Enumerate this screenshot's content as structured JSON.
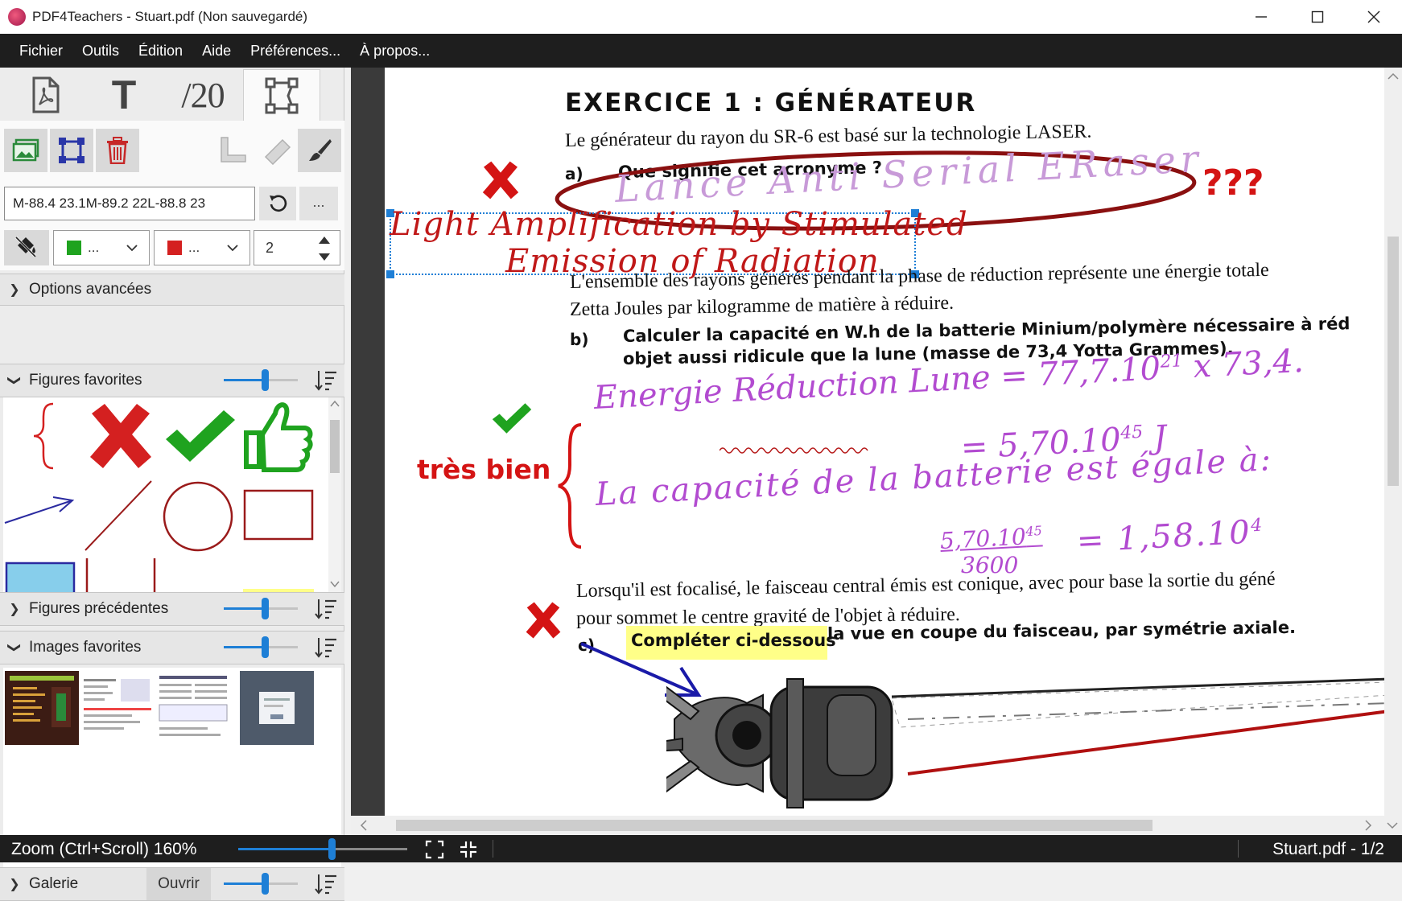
{
  "window": {
    "title": "PDF4Teachers - Stuart.pdf (Non sauvegardé)"
  },
  "menu": [
    "Fichier",
    "Outils",
    "Édition",
    "Aide",
    "Préférences...",
    "À propos..."
  ],
  "sidebar": {
    "tabs": [
      {
        "icon": "pdf-file-icon"
      },
      {
        "label": "T",
        "icon": "text-tool-icon"
      },
      {
        "label": "/20",
        "icon": "grades-icon"
      },
      {
        "icon": "vector-shape-icon",
        "active": true
      }
    ],
    "tools": [
      "add-image-icon",
      "select-shape-icon",
      "delete-icon",
      "ruler-angle-icon",
      "ruler-icon",
      "brush-icon"
    ],
    "path_value": "M-88.4 23.1M-89.2 22L-88.8 23",
    "more_label": "...",
    "fill_color": "#1fa31f",
    "stroke_color": "#d42020",
    "color_dots": "...",
    "stroke_width": "2",
    "sections": {
      "advanced": "Options avancées",
      "favorites": "Figures favorites",
      "previous": "Figures précédentes",
      "images": "Images favorites",
      "gallery": "Galerie",
      "open_label": "Ouvrir"
    },
    "slider_levels": {
      "favorites": 0.55,
      "previous": 0.55,
      "images": 0.55,
      "gallery": 0.55
    }
  },
  "document": {
    "title": "EXERCICE 1 : GÉNÉRATEUR",
    "line1": "Le générateur du rayon du SR-6 est basé sur la technologie LASER.",
    "q_a_label": "a)",
    "q_a": "Que signifie cet acronyme  ?",
    "answer_a": "Lance Anti Serial ERaser",
    "question_marks": "???",
    "correction": "Light Amplification by Stimulated",
    "correction2": "Emission of Radiation",
    "para2_line1": "L'ensemble des rayons générés pendant la phase de réduction représente une énergie totale",
    "para2_line2": "Zetta Joules par kilogramme de matière à réduire.",
    "q_b_label": "b)",
    "q_b_line1": "Calculer la capacité en W.h de la batterie Minium/polymère nécessaire à réd",
    "q_b_line2": "objet aussi ridicule que la lune (masse de 73,4 Yotta Grammes).",
    "comment": "très bien",
    "hand_b1": "Energie Réduction Lune = 77,7.10",
    "hand_b1_exp": "21",
    "hand_b1_tail": "x 73,4.",
    "hand_b2": "= 5,70.10",
    "hand_b2_exp": "45",
    "hand_b2_unit": "J",
    "hand_b3": "La capacité de la batterie est égale à:",
    "hand_b4_num": "5,70.10",
    "hand_b4_num_exp": "45",
    "hand_b4_den": "3600",
    "hand_b4_res": "= 1,58.10",
    "hand_b4_res_exp": "4",
    "para3_line1": "Lorsqu'il est focalisé, le faisceau central émis est conique, avec pour base la sortie du géné",
    "para3_line2": "pour sommet le centre gravité de l'objet à réduire.",
    "q_c_label": "c)",
    "q_c_highlight": "Compléter ci-dessous",
    "q_c_rest": "la vue en coupe du faisceau, par symétrie axiale."
  },
  "status": {
    "zoom_label": "Zoom (Ctrl+Scroll) 160%",
    "zoom_level": 0.55,
    "page_label": "Stuart.pdf - 1/2"
  },
  "colors": {
    "accent": "#1e7fd6",
    "red_annot": "#d41414",
    "green_annot": "#1fa31f",
    "handwriting": "#b24bd0",
    "dark_bar": "#1e1e1e"
  }
}
